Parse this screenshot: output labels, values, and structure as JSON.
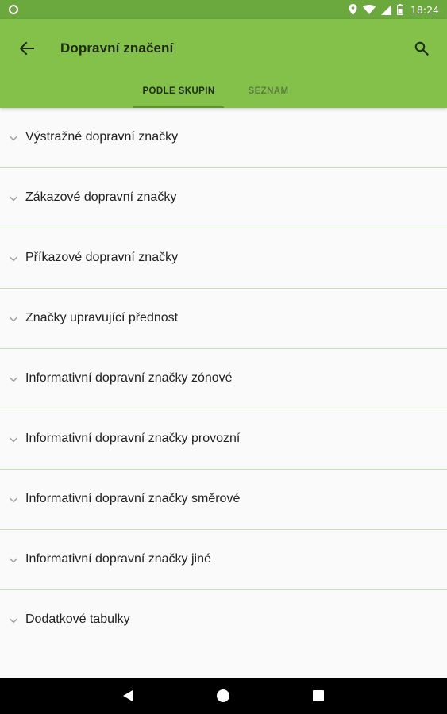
{
  "status_bar": {
    "time": "18:24",
    "icons": [
      "circle-notification-icon",
      "location-icon",
      "wifi-icon",
      "signal-icon",
      "battery-icon"
    ]
  },
  "header": {
    "title": "Dopravní značení",
    "back_icon": "arrow-back-icon",
    "search_icon": "search-icon"
  },
  "tabs": [
    {
      "label": "PODLE SKUPIN",
      "selected": true
    },
    {
      "label": "SEZNAM",
      "selected": false
    }
  ],
  "groups": [
    {
      "label": "Výstražné dopravní značky"
    },
    {
      "label": "Zákazové dopravní značky"
    },
    {
      "label": "Příkazové dopravní značky"
    },
    {
      "label": "Značky upravující přednost"
    },
    {
      "label": "Informativní dopravní značky zónové"
    },
    {
      "label": "Informativní dopravní značky provozní"
    },
    {
      "label": "Informativní dopravní značky směrové"
    },
    {
      "label": "Informativní dopravní značky jiné"
    },
    {
      "label": "Dodatkové tabulky"
    }
  ],
  "nav_bar": {
    "icons": [
      "nav-back-icon",
      "nav-home-icon",
      "nav-recents-icon"
    ]
  },
  "colors": {
    "app_bar": "#83c14b",
    "status_bar": "#6ba83e",
    "tab_indicator": "#5f9333",
    "divider": "#c9e0b4",
    "background": "#fafafa"
  }
}
